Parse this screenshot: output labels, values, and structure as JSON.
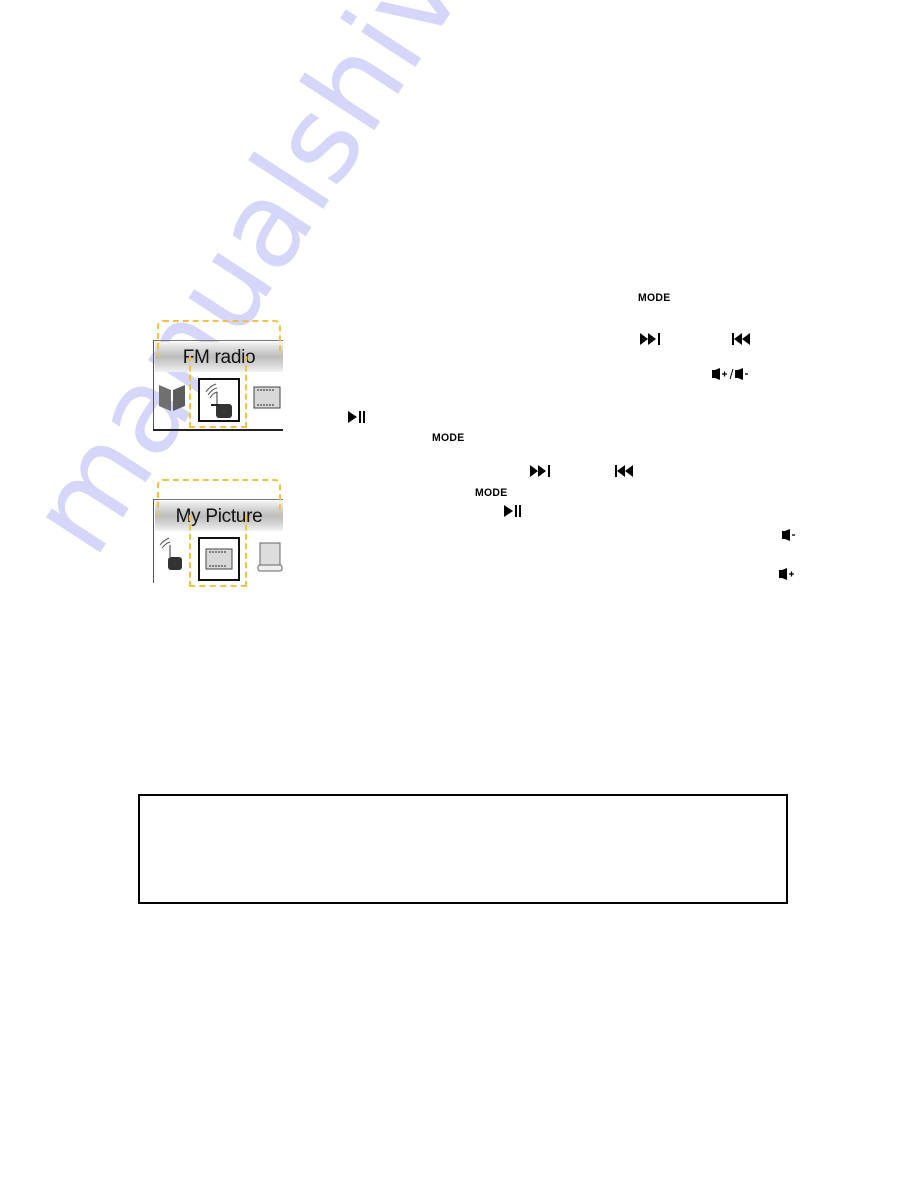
{
  "watermark": "manualshive.com",
  "screens": [
    {
      "title": "FM radio",
      "icons": [
        "book-icon",
        "radio-icon",
        "picture-icon"
      ],
      "selected_icon": "radio-icon"
    },
    {
      "title": "My Picture",
      "icons": [
        "radio-icon",
        "picture-icon",
        "cylinder-icon"
      ],
      "selected_icon": "picture-icon"
    }
  ],
  "button_labels": {
    "mode": "MODE"
  },
  "glyphs": {
    "next": "▶▶|",
    "prev": "|◀◀",
    "play_pause": "▶||",
    "vol_up_down": "vol+ / vol-",
    "vol_down": "vol-",
    "vol_up": "vol+"
  },
  "colors": {
    "highlight_dash": "#f0c24a",
    "watermark": "#d6d6fb"
  },
  "notice_box": {
    "text": ""
  }
}
